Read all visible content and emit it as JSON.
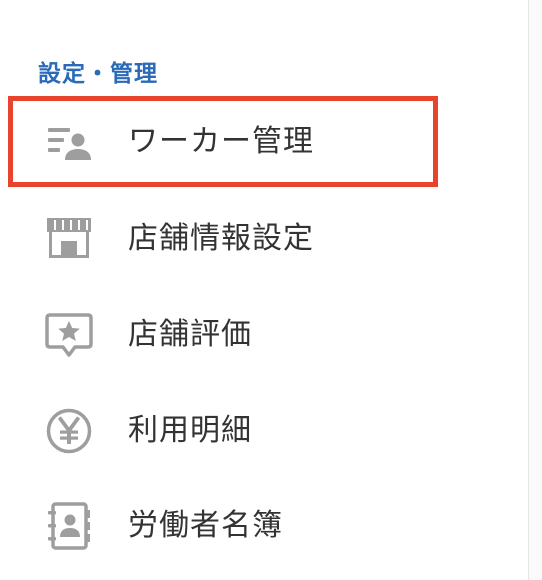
{
  "section": {
    "title": "設定・管理"
  },
  "menu": {
    "items": [
      {
        "label": "ワーカー管理",
        "icon": "worker-list-icon"
      },
      {
        "label": "店舗情報設定",
        "icon": "store-icon"
      },
      {
        "label": "店舗評価",
        "icon": "star-review-icon"
      },
      {
        "label": "利用明細",
        "icon": "yen-icon"
      },
      {
        "label": "労働者名簿",
        "icon": "address-book-icon"
      }
    ]
  },
  "colors": {
    "section_title": "#2a6ab8",
    "highlight_border": "#e8432d",
    "icon": "#9e9e9e",
    "label": "#333333"
  }
}
